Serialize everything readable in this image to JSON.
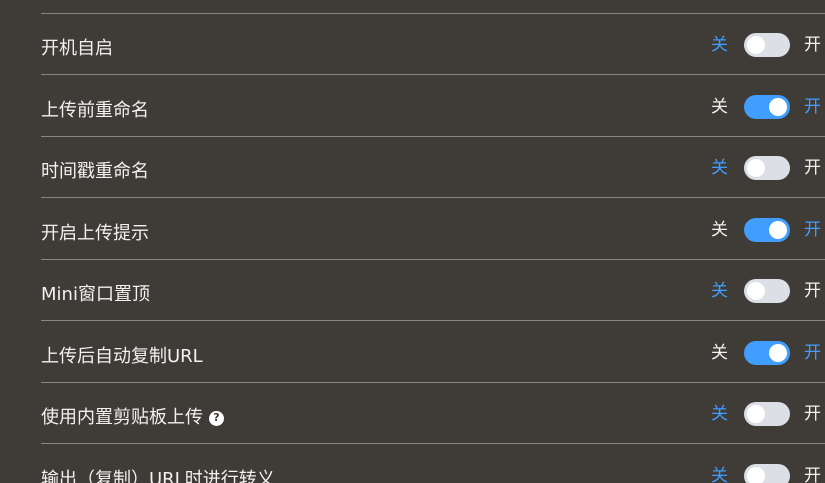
{
  "settings": {
    "off_text": "关",
    "on_text": "开",
    "accent_color": "#409eff",
    "items": [
      {
        "label": "开机自启",
        "state": "off",
        "help_icon": false
      },
      {
        "label": "上传前重命名",
        "state": "on",
        "help_icon": false
      },
      {
        "label": "时间戳重命名",
        "state": "off",
        "help_icon": false
      },
      {
        "label": "开启上传提示",
        "state": "on",
        "help_icon": false
      },
      {
        "label": "Mini窗口置顶",
        "state": "off",
        "help_icon": false
      },
      {
        "label": "上传后自动复制URL",
        "state": "on",
        "help_icon": false
      },
      {
        "label": "使用内置剪贴板上传",
        "state": "off",
        "help_icon": true,
        "help_icon_name": "question-circle-icon",
        "help_icon_glyph": "?"
      },
      {
        "label": "输出（复制）URL时进行转义",
        "state": "off",
        "help_icon": false
      }
    ]
  }
}
